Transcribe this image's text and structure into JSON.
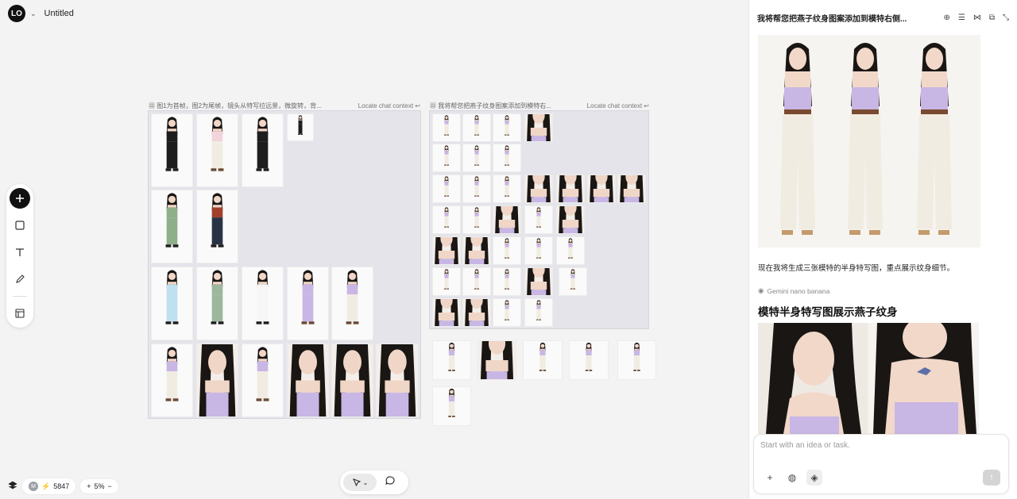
{
  "app": {
    "logo_text": "LO",
    "title": "Untitled"
  },
  "toolbar": {
    "items": [
      "add",
      "rectangle",
      "text",
      "pencil",
      "layout"
    ]
  },
  "status": {
    "avatar_initial": "M",
    "credits": "5847",
    "zoom": "5%"
  },
  "frames": {
    "left": {
      "title": "图1为首帧，图2为尾帧，镜头从特写拉远景，微旋转，背...",
      "locate": "Locate chat context"
    },
    "middle": {
      "title": "我将帮您把燕子纹身图案添加到模特右...",
      "locate": "Locate chat context"
    }
  },
  "panel": {
    "title": "我将帮您把燕子纹身图案添加到模特右侧...",
    "message": "现在我将生成三张模特的半身特写图，重点展示纹身细节。",
    "model": "Gemini nano banana",
    "heading": "模特半身特写图展示燕子纹身"
  },
  "composer": {
    "placeholder": "Start with an idea or task."
  },
  "colors": {
    "accent": "#111111",
    "frame_bg": "#e4e4ea",
    "top_lavender": "#c9b8e8",
    "pants_cream": "#f1ece2"
  }
}
